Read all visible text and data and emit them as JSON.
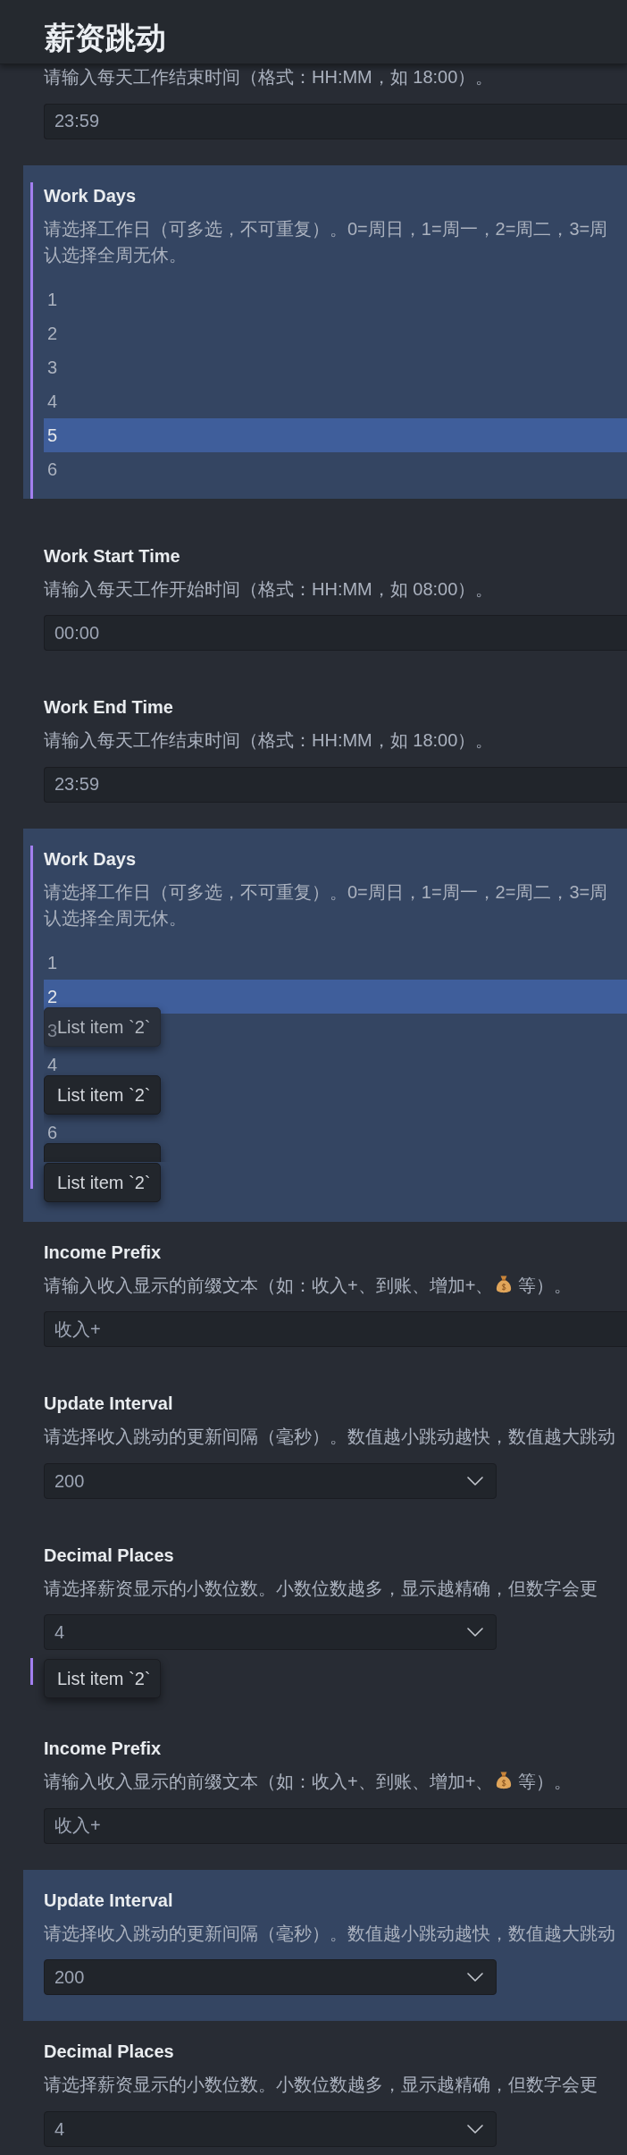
{
  "header": {
    "title": "薪资跳动"
  },
  "settings": [
    {
      "kind": "text",
      "highlighted": false,
      "drop_target": false,
      "description": "请输入每天工作结束时间（格式：HH:MM，如 18:00）。",
      "value": "23:59"
    },
    {
      "kind": "multiselect",
      "highlighted": true,
      "drop_target": true,
      "title": "Work Days",
      "description_lines": [
        "请选择工作日（可多选，不可重复）。0=周日，1=周一，2=周二，3=周",
        "认选择全周无休。"
      ],
      "options": [
        {
          "kind": "option",
          "label": "1",
          "selected": false
        },
        {
          "kind": "option",
          "label": "2",
          "selected": false
        },
        {
          "kind": "option",
          "label": "3",
          "selected": false
        },
        {
          "kind": "option",
          "label": "4",
          "selected": false
        },
        {
          "kind": "option",
          "label": "5",
          "selected": true
        },
        {
          "kind": "option",
          "label": "6",
          "selected": false
        }
      ]
    },
    {
      "kind": "text",
      "highlighted": false,
      "drop_target": false,
      "title": "Work Start Time",
      "description": "请输入每天工作开始时间（格式：HH:MM，如 08:00）。",
      "value": "00:00"
    },
    {
      "kind": "text",
      "highlighted": false,
      "drop_target": false,
      "title": "Work End Time",
      "description": "请输入每天工作结束时间（格式：HH:MM，如 18:00）。",
      "value": "23:59"
    },
    {
      "kind": "multiselect",
      "highlighted": true,
      "drop_target": true,
      "title": "Work Days",
      "description_lines": [
        "请选择工作日（可多选，不可重复）。0=周日，1=周一，2=周二，3=周",
        "认选择全周无休。"
      ],
      "options": [
        {
          "kind": "option",
          "label": "1",
          "selected": false
        },
        {
          "kind": "option",
          "label": "2",
          "selected": true
        },
        {
          "kind": "option",
          "label": "3",
          "selected": false,
          "ghost": "List item `2`"
        },
        {
          "kind": "option",
          "label": "4",
          "selected": false
        },
        {
          "kind": "covered",
          "selected": false,
          "ghost": "List item `2`"
        },
        {
          "kind": "option",
          "label": "6",
          "selected": false
        },
        {
          "kind": "covered",
          "selected": false
        }
      ],
      "trailing_ghost": "List item `2`"
    },
    {
      "kind": "text",
      "highlighted": false,
      "drop_target": false,
      "title": "Income Prefix",
      "description_parts": [
        "请输入收入显示的前缀文本（如：收入+、到账、增加+、",
        "等）。"
      ],
      "value": "收入+"
    },
    {
      "kind": "select",
      "highlighted": false,
      "drop_target": false,
      "title": "Update Interval",
      "description": "请选择收入跳动的更新间隔（毫秒）。数值越小跳动越快，数值越大跳动",
      "value": "200"
    },
    {
      "kind": "select",
      "highlighted": false,
      "drop_target": false,
      "title": "Decimal Places",
      "description": "请选择薪资显示的小数位数。小数位数越多，显示越精确，但数字会更",
      "value": "4"
    },
    {
      "kind": "placeholder",
      "highlighted": false,
      "drop_target": true,
      "trailing_ghost": "List item `2`"
    },
    {
      "kind": "text",
      "highlighted": false,
      "drop_target": false,
      "title": "Income Prefix",
      "description_parts": [
        "请输入收入显示的前缀文本（如：收入+、到账、增加+、",
        "等）。"
      ],
      "value": "收入+"
    },
    {
      "kind": "select",
      "highlighted": true,
      "drop_target": false,
      "title": "Update Interval",
      "description": "请选择收入跳动的更新间隔（毫秒）。数值越小跳动越快，数值越大跳动",
      "value": "200"
    },
    {
      "kind": "select",
      "highlighted": false,
      "drop_target": false,
      "title": "Decimal Places",
      "description": "请选择薪资显示的小数位数。小数位数越多，显示越精确，但数字会更",
      "value": "4"
    }
  ]
}
